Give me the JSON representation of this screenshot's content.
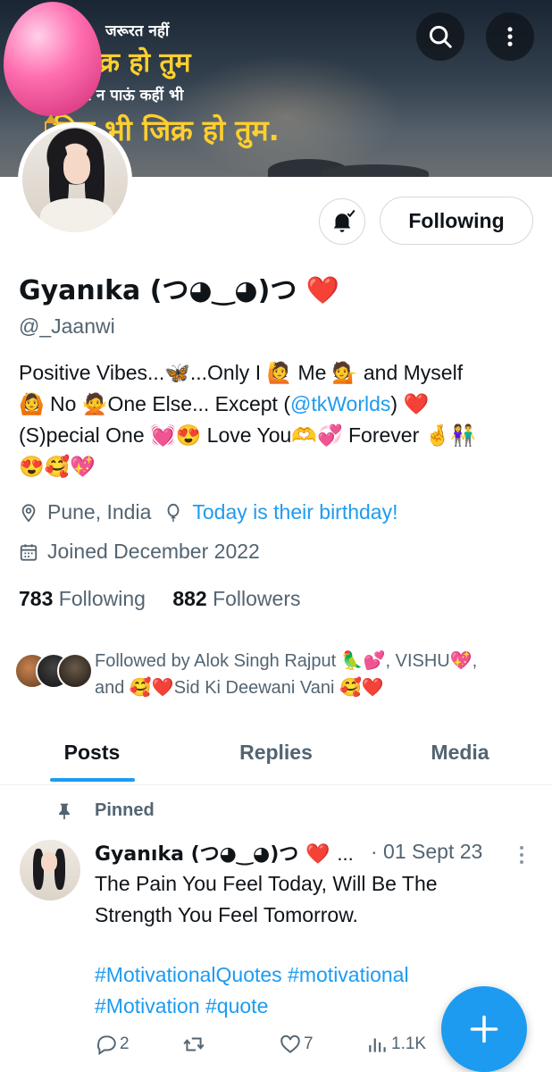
{
  "banner": {
    "line1": "जरूरत नहीं",
    "line2": "फ़िक्र हो तुम",
    "line3": "कर न पाऊं कहीं भी",
    "line4": "फिर भी जिक्र हो तुम."
  },
  "profile": {
    "follow_label": "Following",
    "name": "Gyanıka (つ◕‿◕)つ",
    "name_emoji": "❤️",
    "handle": "@_Jaanwi",
    "bio": {
      "line1": "Positive Vibes...🦋...Only I 🙋 Me 💁 and Myself",
      "line2_prefix": "🙆 No 🙅One Else... Except (",
      "line2_link": "@tkWorlds",
      "line2_suffix": ") ❤️",
      "line3": "(S)pecial One 💓😍 Love You🫶💞 Forever 🤞👫",
      "line4": "😍🥰💖"
    },
    "location": "Pune, India",
    "birthday": "Today is their birthday!",
    "joined": "Joined December 2022",
    "following_count": "783",
    "following_label": "Following",
    "followers_count": "882",
    "followers_label": "Followers",
    "followed_by_line1": "Followed by Alok Singh Rajput 🦜💕, VISHU💖,",
    "followed_by_line2": "and 🥰❤️Sid Ki Deewani Vani 🥰❤️"
  },
  "tabs": [
    {
      "label": "Posts",
      "selected": true
    },
    {
      "label": "Replies",
      "selected": false
    },
    {
      "label": "Media",
      "selected": false
    }
  ],
  "post": {
    "pinned_label": "Pinned",
    "author_name": "Gyanıka (つ◕‿◕)つ",
    "author_emoji": "❤️",
    "ellipsis": "...",
    "date": "· 01 Sept 23",
    "text_line1": "The Pain You Feel Today, Will Be The",
    "text_line2": "Strength You Feel Tomorrow.",
    "hashtags_line1": "#MotivationalQuotes #motivational",
    "hashtags_line2": "#Motivation #quote",
    "replies": "2",
    "reposts": "",
    "likes": "7",
    "views": "1.1K"
  },
  "colors": {
    "accent": "#1d9bf0",
    "text": "#0f1419",
    "secondary": "#536471"
  },
  "icons": [
    "search-icon",
    "more-vertical-icon",
    "bell-subscribed-icon",
    "location-pin-icon",
    "balloon-icon",
    "calendar-icon",
    "pin-icon",
    "reply-icon",
    "repost-icon",
    "like-icon",
    "views-icon",
    "plus-icon"
  ]
}
